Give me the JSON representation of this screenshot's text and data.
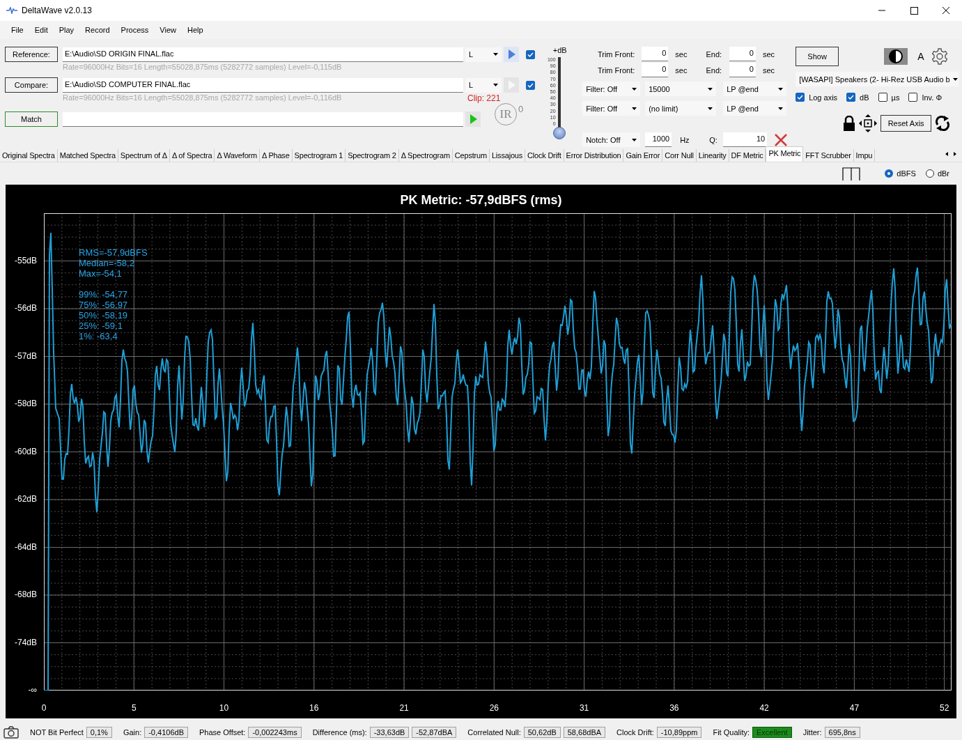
{
  "window": {
    "title": "DeltaWave v2.0.13"
  },
  "menu": [
    "File",
    "Edit",
    "Play",
    "Record",
    "Process",
    "View",
    "Help"
  ],
  "sources": [
    {
      "button": "Reference:",
      "path": "E:\\Audio\\SD ORIGIN FINAL.flac",
      "info": "Rate=96000Hz Bits=16 Length=55028,875ms (5282772 samples) Level=-0,115dB",
      "channel": "L",
      "play_enabled": true,
      "checked": true
    },
    {
      "button": "Compare:",
      "path": "E:\\Audio\\SD COMPUTER FINAL.flac",
      "info": "Rate=96000Hz Bits=16 Length=55028,875ms (5282772 samples) Level=-0,116dB",
      "channel": "L",
      "play_enabled": false,
      "checked": true,
      "clip": "Clip: 221"
    }
  ],
  "match": {
    "button": "Match",
    "level": 0
  },
  "ir": {
    "label": "IR",
    "count": "0"
  },
  "gain_slider": {
    "label": "+dB",
    "scale": [
      "100",
      "90",
      "80",
      "70",
      "60",
      "50",
      "40",
      "30",
      "20",
      "10",
      "0"
    ],
    "level": 0
  },
  "trim": [
    {
      "label": "Trim Front:",
      "value": "0",
      "unit": "sec",
      "end_label": "End:",
      "end_value": "0",
      "end_unit": "sec"
    },
    {
      "label": "Trim Front:",
      "value": "0",
      "unit": "sec",
      "end_label": "End:",
      "end_value": "0",
      "end_unit": "sec"
    }
  ],
  "filters": [
    {
      "mode": "Filter: Off",
      "value": "15000",
      "type": "LP @end"
    },
    {
      "mode": "Filter: Off",
      "value": "(no limit)",
      "type": "LP @end"
    }
  ],
  "notch": {
    "mode": "Notch: Off",
    "freq": "1000",
    "unit": "Hz",
    "q_label": "Q:",
    "q": "10"
  },
  "show_button": "Show",
  "font_button": "A",
  "device": "[WASAPI] Speakers (2- Hi-Rez USB Audio b",
  "options": [
    {
      "label": "Log axis",
      "checked": true
    },
    {
      "label": "dB",
      "checked": true
    },
    {
      "label": "µs",
      "checked": false
    },
    {
      "label": "Inv. Φ",
      "checked": false
    }
  ],
  "reset_button": "Reset Axis",
  "tabs": [
    {
      "label": "Original Spectra",
      "selected": false
    },
    {
      "label": "Matched Spectra",
      "selected": false
    },
    {
      "label": "Spectrum of Δ",
      "selected": false
    },
    {
      "label": "Δ of Spectra",
      "selected": false
    },
    {
      "label": "Δ Waveform",
      "selected": false
    },
    {
      "label": "Δ Phase",
      "selected": false
    },
    {
      "label": "Spectrogram 1",
      "selected": false
    },
    {
      "label": "Spectrogram 2",
      "selected": false
    },
    {
      "label": "Δ Spectrogram",
      "selected": false
    },
    {
      "label": "Cepstrum",
      "selected": false
    },
    {
      "label": "Lissajous",
      "selected": false
    },
    {
      "label": "Clock Drift",
      "selected": false
    },
    {
      "label": "Error Distribution",
      "selected": false
    },
    {
      "label": "Gain Error",
      "selected": false
    },
    {
      "label": "Corr Null",
      "selected": false
    },
    {
      "label": "Linearity",
      "selected": false
    },
    {
      "label": "DF Metric",
      "selected": false
    },
    {
      "label": "PK Metric",
      "selected": true
    },
    {
      "label": "FFT Scrubber",
      "selected": false
    },
    {
      "label": "Impu",
      "selected": false
    }
  ],
  "units": [
    {
      "label": "dBFS",
      "selected": true
    },
    {
      "label": "dBr",
      "selected": false
    }
  ],
  "plot": {
    "title": "PK Metric: -57,9dBFS (rms)",
    "stats": [
      [
        "RMS=-57,9dBFS",
        "Median=-58,2",
        "Max=-54,1"
      ],
      [
        "99%: -54,77",
        "75%: -56,97",
        "50%: -58,19",
        "25%: -59,1",
        "1%: -63,4"
      ]
    ],
    "y_labels": [
      "-55dB",
      "-56dB",
      "-57dB",
      "-58dB",
      "-60dB",
      "-62dB",
      "-64dB",
      "-68dB",
      "-74dB",
      "-∞"
    ],
    "x_labels": [
      "0",
      "5",
      "10",
      "16",
      "21",
      "26",
      "31",
      "36",
      "42",
      "47",
      "52"
    ]
  },
  "status": [
    {
      "label": "NOT Bit Perfect",
      "values": [
        "0,1%"
      ],
      "kind": "plain"
    },
    {
      "label": "Gain:",
      "values": [
        "-0,4106dB"
      ],
      "kind": "plain"
    },
    {
      "label": "Phase Offset:",
      "values": [
        "-0,002243ms"
      ],
      "kind": "plain"
    },
    {
      "label": "Difference (ms):",
      "values": [
        "-33,63dB",
        "-52,87dBA"
      ],
      "kind": "plain"
    },
    {
      "label": "Correlated Null:",
      "values": [
        "50,62dB",
        "58,68dBA"
      ],
      "kind": "plain"
    },
    {
      "label": "Clock Drift:",
      "values": [
        "-10,89ppm"
      ],
      "kind": "plain"
    },
    {
      "label": "Fit Quality:",
      "values": [
        "Excellent"
      ],
      "kind": "rating"
    },
    {
      "label": "Jitter:",
      "values": [
        "695,8ns"
      ],
      "kind": "plain"
    }
  ]
}
